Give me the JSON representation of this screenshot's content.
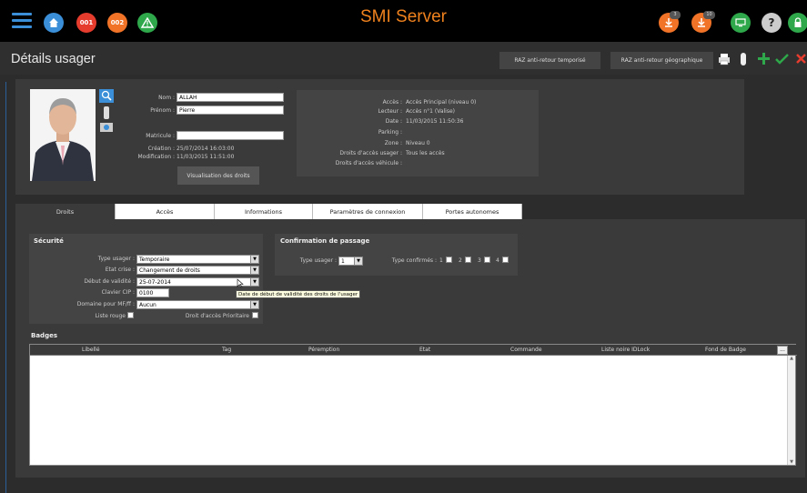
{
  "app": {
    "title": "SMI Server"
  },
  "topbar": {
    "badges": [
      {
        "label": "001",
        "color": "#e63c2e"
      },
      {
        "label": "002",
        "color": "#f07328"
      }
    ],
    "notif_left_count": "3",
    "notif_right_count": "10"
  },
  "header": {
    "page_title": "Détails usager",
    "btn_raz_temp": "RAZ anti-retour temporisé",
    "btn_raz_geo": "RAZ anti-retour géographique"
  },
  "user": {
    "nom_label": "Nom :",
    "nom_value": "ALLAH",
    "prenom_label": "Prénom :",
    "prenom_value": "Pierre",
    "matricule_label": "Matricule :",
    "matricule_value": "",
    "creation_label": "Création :",
    "creation_value": "25/07/2014 16:03:00",
    "modification_label": "Modification :",
    "modification_value": "11/03/2015 11:51:00",
    "btn_visu": "Visualisation des droits"
  },
  "access": {
    "rows": [
      {
        "label": "Accès :",
        "value": "Accès Principal (niveau 0)"
      },
      {
        "label": "Lecteur :",
        "value": "Accès n°1 (Valise)"
      },
      {
        "label": "Date :",
        "value": "11/03/2015 11:50:36"
      },
      {
        "label": "Parking :",
        "value": ""
      },
      {
        "label": "Zone :",
        "value": "Niveau 0"
      },
      {
        "label": "Droits d'accès usager :",
        "value": "Tous les accès"
      },
      {
        "label": "Droits d'accès véhicule :",
        "value": ""
      }
    ]
  },
  "tabs": [
    "Droits",
    "Accès",
    "Informations",
    "Paramètres de connexion",
    "Portes autonomes"
  ],
  "securite": {
    "title": "Sécurité",
    "type_usager_label": "Type usager :",
    "type_usager_value": "Temporaire",
    "etat_crise_label": "Etat crise :",
    "etat_crise_value": "Changement de droits",
    "debut_label": "Début de validité :",
    "debut_value": "25-07-2014",
    "clavier_label": "Clavier CIP :",
    "clavier_value": "0100",
    "domaine_label": "Domaine pour MF/ff :",
    "domaine_value": "Aucun",
    "liste_rouge_label": "Liste rouge",
    "droit_prio_label": "Droit d'accès Prioritaire"
  },
  "tooltip": "Date de début de validité des droits de l'usager",
  "confirmation": {
    "title": "Confirmation de passage",
    "type_usager_label": "Type usager :",
    "type_usager_value": "1",
    "types_confirmes_label": "Type confirmés :",
    "checks": [
      "1",
      "2",
      "3",
      "4"
    ]
  },
  "badges": {
    "title": "Badges",
    "columns": [
      "Libellé",
      "Tag",
      "Péremption",
      "Etat",
      "Commande",
      "Liste noire IDLock",
      "Fond de Badge"
    ],
    "more": "..."
  }
}
